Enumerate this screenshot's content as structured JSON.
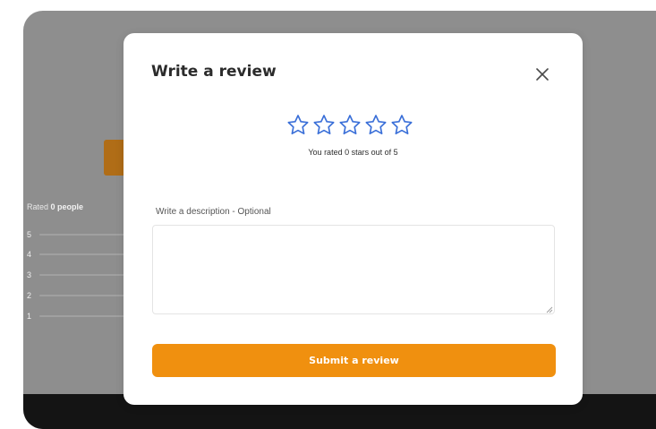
{
  "background": {
    "rated_prefix": "Rated",
    "rated_count_label": "0 people",
    "rating_rows": [
      {
        "label": "5",
        "fraction": 0
      },
      {
        "label": "4",
        "fraction": 0
      },
      {
        "label": "3",
        "fraction": 0
      },
      {
        "label": "2",
        "fraction": 0
      },
      {
        "label": "1",
        "fraction": 0
      }
    ]
  },
  "modal": {
    "title": "Write a review",
    "close_icon": "close-icon",
    "stars": {
      "total": 5,
      "rated": 0,
      "icon": "star-outline-icon",
      "color": "#3a6fd8"
    },
    "rated_text": "You rated 0 stars out of 5",
    "description_label": "Write a description - Optional",
    "description_value": "",
    "submit_label": "Submit a review"
  },
  "colors": {
    "accent": "#f0900f",
    "star": "#3a6fd8",
    "overlay": "#8e8e8e",
    "footer": "#141414"
  }
}
